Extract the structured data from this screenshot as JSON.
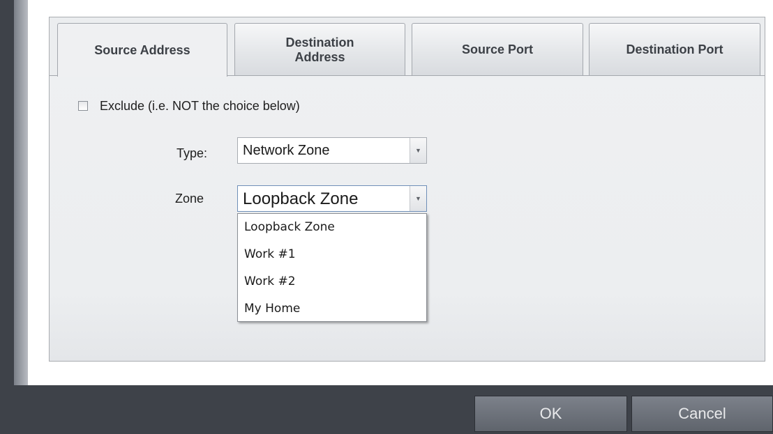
{
  "tabs": [
    {
      "label": "Source Address",
      "active": true
    },
    {
      "label": "Destination\nAddress",
      "active": false
    },
    {
      "label": "Source Port",
      "active": false
    },
    {
      "label": "Destination Port",
      "active": false
    }
  ],
  "exclude": {
    "label": "Exclude (i.e. NOT the choice below)",
    "checked": false
  },
  "type_field": {
    "label": "Type:",
    "value": "Network Zone"
  },
  "zone_field": {
    "label": "Zone",
    "value": "Loopback Zone"
  },
  "zone_options": [
    "Loopback Zone",
    "Work #1",
    "Work #2",
    "My Home"
  ],
  "buttons": {
    "ok": "OK",
    "cancel": "Cancel"
  }
}
